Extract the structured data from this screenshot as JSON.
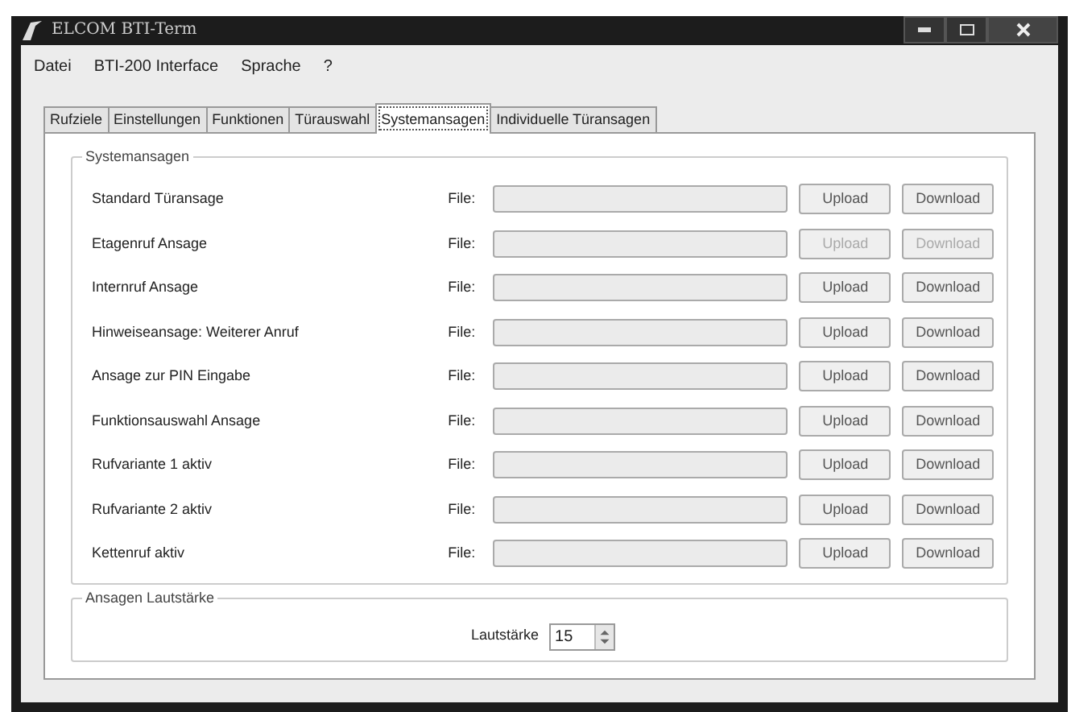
{
  "window": {
    "title": "ELCOM BTI-Term"
  },
  "menu": [
    "Datei",
    "BTI-200 Interface",
    "Sprache",
    "?"
  ],
  "tabs": [
    {
      "label": "Rufziele",
      "selected": false
    },
    {
      "label": "Einstellungen",
      "selected": false
    },
    {
      "label": "Funktionen",
      "selected": false
    },
    {
      "label": "Türauswahl",
      "selected": false
    },
    {
      "label": "Systemansagen",
      "selected": true
    },
    {
      "label": "Individuelle Türansagen",
      "selected": false
    }
  ],
  "group": {
    "title": "Systemansagen",
    "rows": [
      {
        "label": "Standard Türansage",
        "file_label": "File:",
        "upload": "Upload",
        "download": "Download",
        "disabled": false
      },
      {
        "label": "Etagenruf Ansage",
        "file_label": "File:",
        "upload": "Upload",
        "download": "Download",
        "disabled": true
      },
      {
        "label": "Internruf Ansage",
        "file_label": "File:",
        "upload": "Upload",
        "download": "Download",
        "disabled": false
      },
      {
        "label": "Hinweiseansage: Weiterer Anruf",
        "file_label": "File:",
        "upload": "Upload",
        "download": "Download",
        "disabled": false
      },
      {
        "label": "Ansage zur PIN Eingabe",
        "file_label": "File:",
        "upload": "Upload",
        "download": "Download",
        "disabled": false
      },
      {
        "label": "Funktionsauswahl Ansage",
        "file_label": "File:",
        "upload": "Upload",
        "download": "Download",
        "disabled": false
      },
      {
        "label": "Rufvariante 1 aktiv",
        "file_label": "File:",
        "upload": "Upload",
        "download": "Download",
        "disabled": false
      },
      {
        "label": "Rufvariante 2 aktiv",
        "file_label": "File:",
        "upload": "Upload",
        "download": "Download",
        "disabled": false
      },
      {
        "label": "Kettenruf aktiv",
        "file_label": "File:",
        "upload": "Upload",
        "download": "Download",
        "disabled": false
      }
    ]
  },
  "volume": {
    "title": "Ansagen Lautstärke",
    "label": "Lautstärke",
    "value": "15"
  }
}
